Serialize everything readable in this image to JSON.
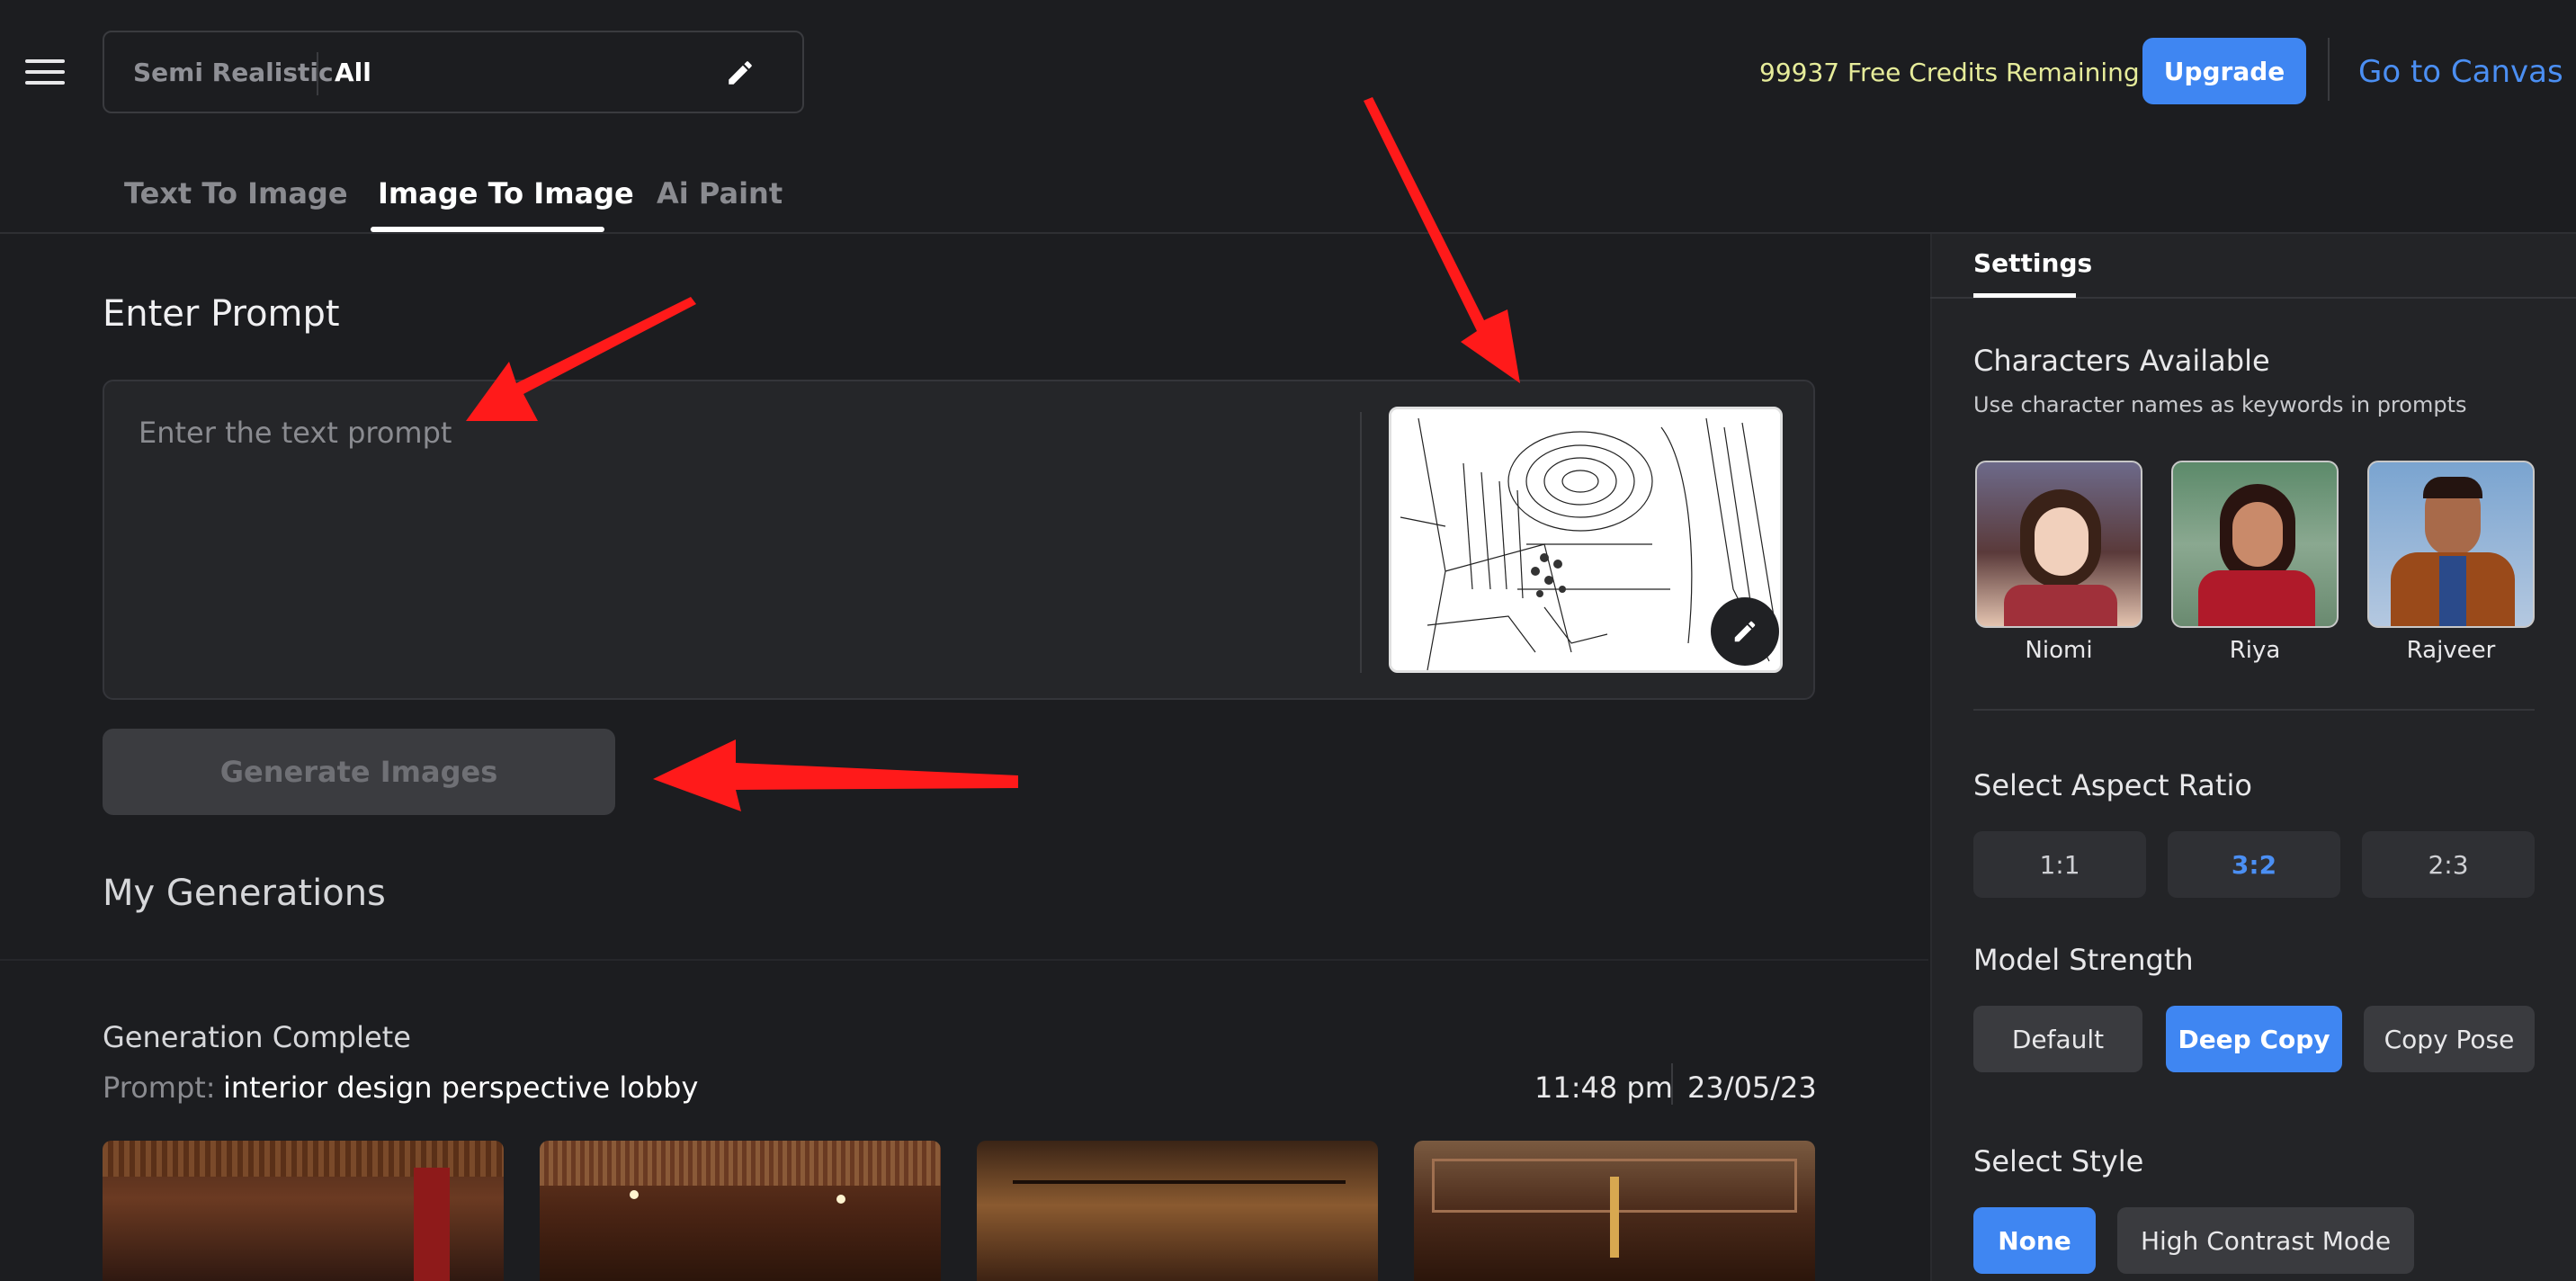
{
  "header": {
    "style_label": "Semi Realistic",
    "category_label": "All",
    "credits_text": "99937 Free Credits Remaining",
    "upgrade_label": "Upgrade",
    "canvas_link": "Go to Canvas"
  },
  "tabs": [
    {
      "label": "Text To Image",
      "active": false
    },
    {
      "label": "Image To Image",
      "active": true
    },
    {
      "label": "Ai Paint",
      "active": false
    }
  ],
  "main": {
    "prompt_heading": "Enter Prompt",
    "prompt_placeholder": "Enter the text prompt",
    "generate_label": "Generate Images",
    "generations_heading": "My Generations",
    "generation": {
      "status": "Generation Complete",
      "prompt_label": "Prompt:",
      "prompt_text": "interior design perspective lobby",
      "time": "11:48 pm",
      "date": "23/05/23"
    }
  },
  "sidebar": {
    "tab_label": "Settings",
    "characters_heading": "Characters Available",
    "characters_sub": "Use character names as keywords in prompts",
    "characters": [
      {
        "name": "Niomi"
      },
      {
        "name": "Riya"
      },
      {
        "name": "Rajveer"
      }
    ],
    "aspect_heading": "Select Aspect Ratio",
    "aspect_options": [
      {
        "label": "1:1",
        "selected": false
      },
      {
        "label": "3:2",
        "selected": true
      },
      {
        "label": "2:3",
        "selected": false
      }
    ],
    "strength_heading": "Model Strength",
    "strength_options": [
      {
        "label": "Default",
        "selected": false
      },
      {
        "label": "Deep Copy",
        "selected": true
      },
      {
        "label": "Copy Pose",
        "selected": false
      }
    ],
    "style_heading": "Select Style",
    "style_options": [
      {
        "label": "None",
        "selected": true
      },
      {
        "label": "High Contrast Mode",
        "selected": false
      }
    ]
  },
  "colors": {
    "accent": "#3f86f2",
    "background": "#1c1d20",
    "credits": "#e6ec9a",
    "annotation_arrow": "#ff1a1a"
  }
}
